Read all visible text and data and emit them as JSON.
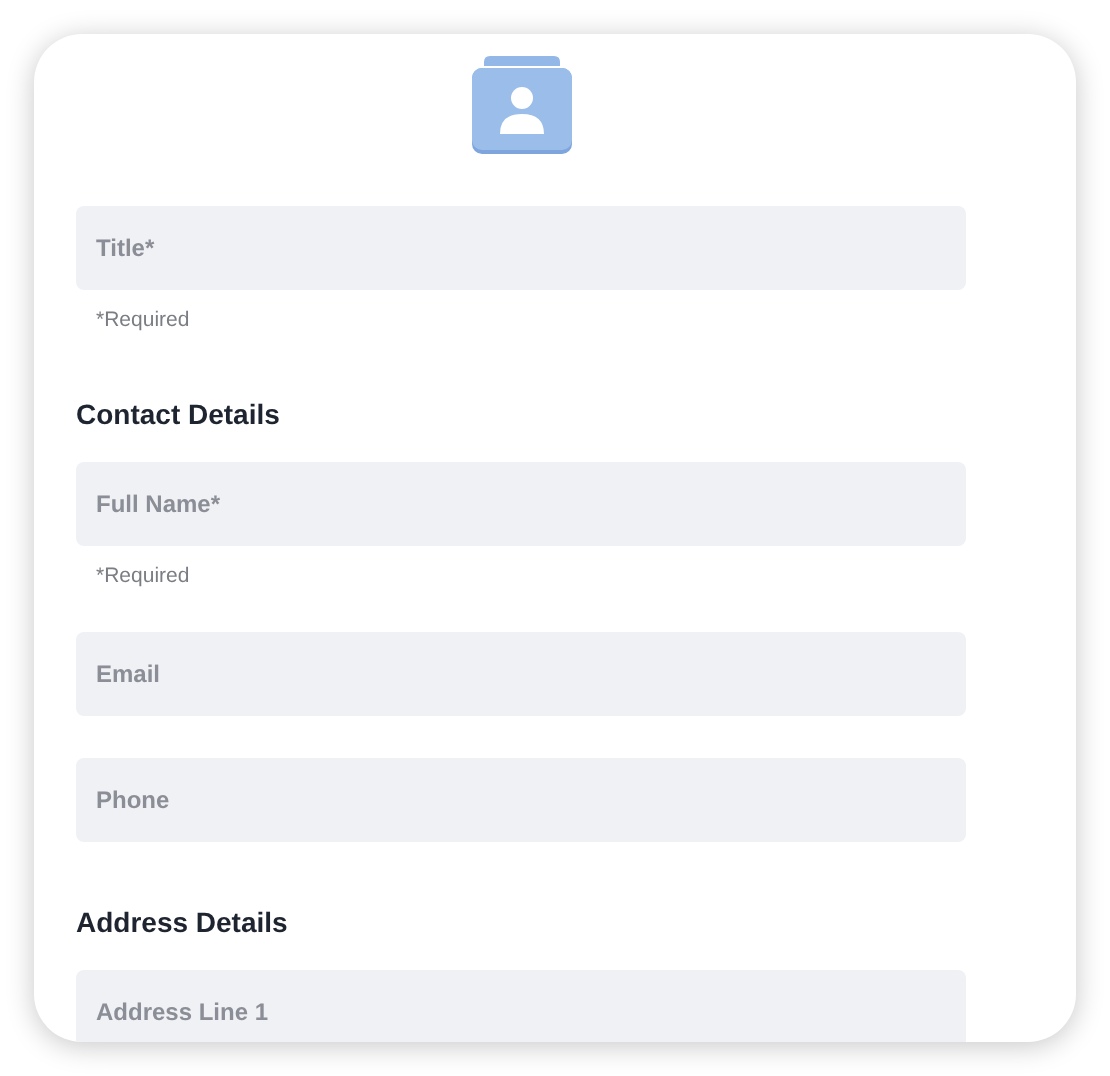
{
  "items": [
    {
      "kind": "field",
      "placeholder": "Title*"
    },
    {
      "kind": "hint",
      "text": "*Required"
    },
    {
      "kind": "heading",
      "text": "Contact Details"
    },
    {
      "kind": "field",
      "placeholder": "Full Name*"
    },
    {
      "kind": "hint",
      "text": "*Required"
    },
    {
      "kind": "field",
      "placeholder": "Email"
    },
    {
      "kind": "field",
      "placeholder": "Phone"
    },
    {
      "kind": "heading",
      "text": "Address Details"
    },
    {
      "kind": "field",
      "placeholder": "Address Line 1"
    }
  ]
}
